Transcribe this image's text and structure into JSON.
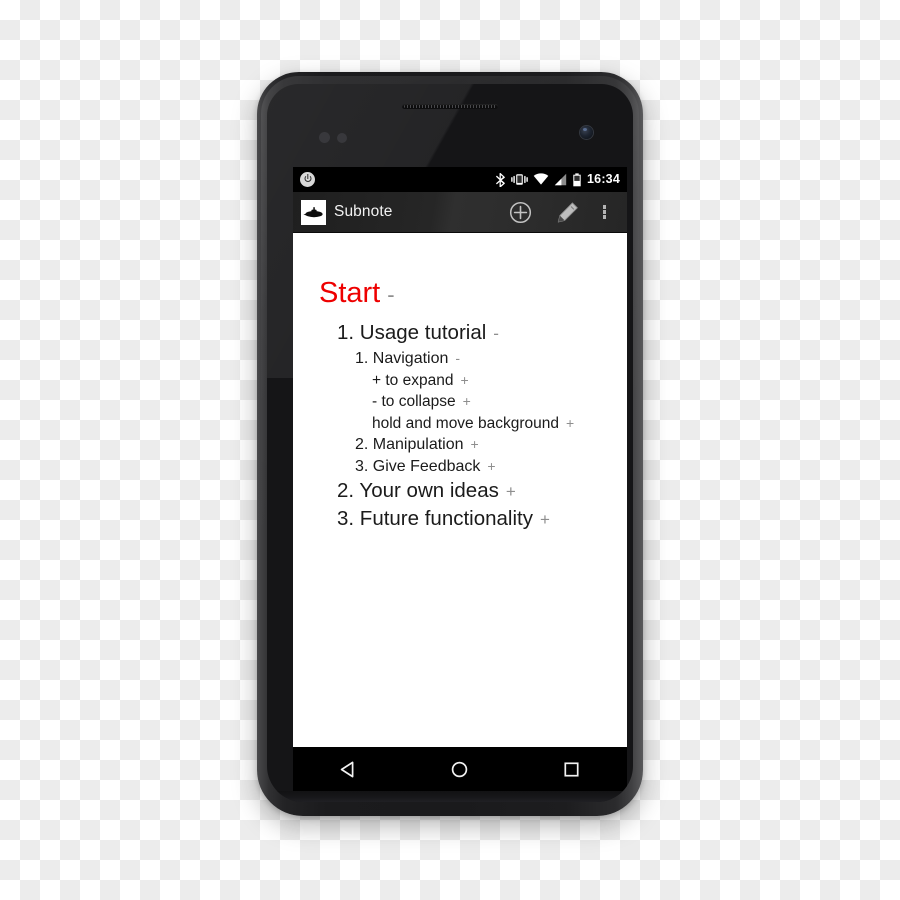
{
  "device": {
    "name": "android-smartphone",
    "frame_color": "#1a1a1c"
  },
  "status_bar": {
    "background": "#000000",
    "left_icons": [
      {
        "name": "power-notification-icon",
        "glyph": "power"
      }
    ],
    "right_icons": [
      {
        "name": "bluetooth-icon",
        "glyph": "bluetooth"
      },
      {
        "name": "vibrate-mode-icon",
        "glyph": "vibrate"
      },
      {
        "name": "wifi-signal-icon",
        "glyph": "wifi"
      },
      {
        "name": "cellular-signal-icon",
        "glyph": "signal"
      },
      {
        "name": "battery-icon",
        "glyph": "battery"
      }
    ],
    "time": "16:34"
  },
  "action_bar": {
    "app_icon_name": "submarine-app-icon",
    "title": "Subnote",
    "actions": [
      {
        "name": "add-node-button",
        "icon": "plus-circle-icon",
        "label": "Add"
      },
      {
        "name": "edit-button",
        "icon": "pencil-icon",
        "label": "Edit"
      },
      {
        "name": "overflow-menu-button",
        "icon": "more-vertical-icon",
        "label": "More options"
      }
    ]
  },
  "note": {
    "accent_color": "#ee0000",
    "marker_color": "#8e8e8e",
    "nodes": [
      {
        "level": 0,
        "text": "Start",
        "marker": "-",
        "accent": true
      },
      {
        "level": 1,
        "text": "1. Usage tutorial",
        "marker": "-",
        "accent": false
      },
      {
        "level": 2,
        "text": "1. Navigation",
        "marker": "-",
        "accent": false
      },
      {
        "level": 3,
        "text": "+ to expand",
        "marker": "+",
        "accent": false
      },
      {
        "level": 3,
        "text": "- to collapse",
        "marker": "+",
        "accent": false
      },
      {
        "level": 3,
        "text": "hold and move background",
        "marker": "+",
        "accent": false
      },
      {
        "level": 2,
        "text": "2. Manipulation",
        "marker": "+",
        "accent": false
      },
      {
        "level": 2,
        "text": "3. Give Feedback",
        "marker": "+",
        "accent": false
      },
      {
        "level": 1,
        "text": "2. Your own ideas",
        "marker": "+",
        "accent": false
      },
      {
        "level": 1,
        "text": "3. Future functionality",
        "marker": "+",
        "accent": false
      }
    ]
  },
  "nav_bar": {
    "background": "#000000",
    "buttons": [
      {
        "name": "back-button",
        "icon": "back-triangle-icon",
        "label": "Back"
      },
      {
        "name": "home-button",
        "icon": "home-circle-icon",
        "label": "Home"
      },
      {
        "name": "recents-button",
        "icon": "recents-square-icon",
        "label": "Recent apps"
      }
    ]
  }
}
